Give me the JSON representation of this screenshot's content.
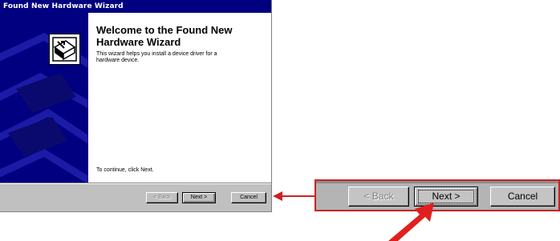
{
  "window": {
    "title": "Found New Hardware Wizard"
  },
  "content": {
    "heading": "Welcome to the Found New Hardware Wizard",
    "description": "This wizard helps you install a device driver for a hardware device.",
    "continue_text": "To continue, click Next."
  },
  "buttons": {
    "back": "< Back",
    "next": "Next >",
    "cancel": "Cancel"
  },
  "zoom_buttons": {
    "back": "< Back",
    "next": "Next >",
    "cancel": "Cancel"
  },
  "colors": {
    "titlebar": "#000080",
    "callout": "#cc2222",
    "dialog_face": "#c0c0c0"
  },
  "icons": [
    "wizard-hardware-icon",
    "pointer-arrow-icon",
    "callout-arrow-icon"
  ]
}
